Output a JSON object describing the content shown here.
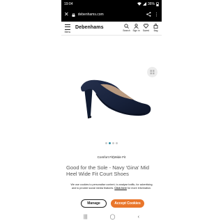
{
  "status_bar": {
    "time": "19:04",
    "battery": "36%"
  },
  "browser": {
    "url": "debenhams.com"
  },
  "header": {
    "logo": "Debenhams",
    "menu_label": "Menu",
    "icons": [
      {
        "name": "search-icon",
        "label": "Search"
      },
      {
        "name": "sign-in-icon",
        "label": "Sign in"
      },
      {
        "name": "saved-icon",
        "label": "Saved"
      },
      {
        "name": "bag-icon",
        "label": "Bag"
      }
    ]
  },
  "product": {
    "fit": "Comfort Fit|Wide Fit",
    "title": "Good for the Sole - Navy 'Gina' Mid Heel Wide Fit Court Shoes",
    "image_dots": 4,
    "active_dot": 2
  },
  "cookie": {
    "text": "We use cookies to personalise content, to analyse traffic, for advertising and to provide social media features.",
    "link": "Click here",
    "text_after": "for more information.",
    "manage_label": "Manage",
    "accept_label": "Accept Cookies"
  },
  "colors": {
    "accent": "#e9762b",
    "shoe": "#17213a",
    "dot_active": "#2d8fa6"
  }
}
